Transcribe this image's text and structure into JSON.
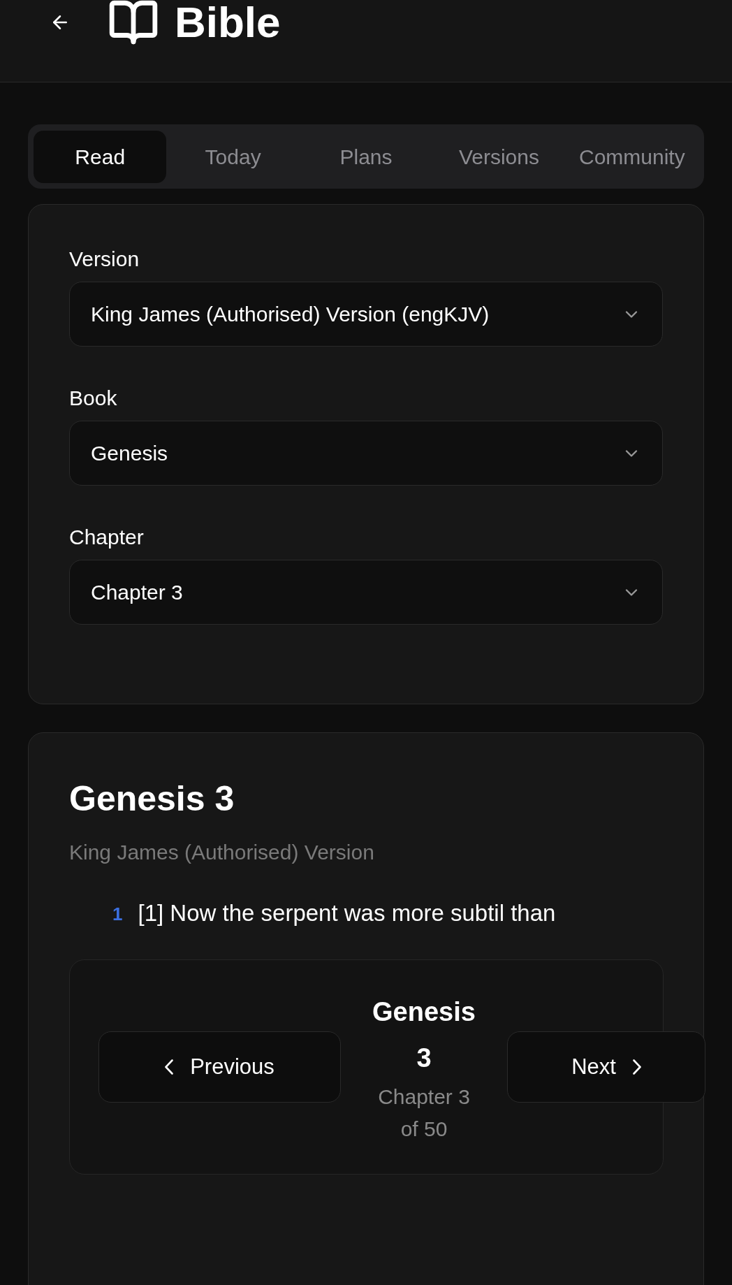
{
  "header": {
    "title": "Bible"
  },
  "tabs": [
    {
      "label": "Read",
      "selected": true
    },
    {
      "label": "Today",
      "selected": false
    },
    {
      "label": "Plans",
      "selected": false
    },
    {
      "label": "Versions",
      "selected": false
    },
    {
      "label": "Community",
      "selected": false
    }
  ],
  "selectors": [
    {
      "label": "Version",
      "value": "King James (Authorised) Version (engKJV)"
    },
    {
      "label": "Book",
      "value": "Genesis"
    },
    {
      "label": "Chapter",
      "value": "Chapter 3"
    }
  ],
  "reading": {
    "title": "Genesis 3",
    "version_name": "King James (Authorised) Version",
    "verses": [
      {
        "number": "1",
        "text": "[1] Now the serpent was more subtil than"
      }
    ]
  },
  "chapter_nav": {
    "previous": "Previous",
    "next": "Next",
    "current": "Genesis 3",
    "position": "Chapter 3 of 50"
  }
}
